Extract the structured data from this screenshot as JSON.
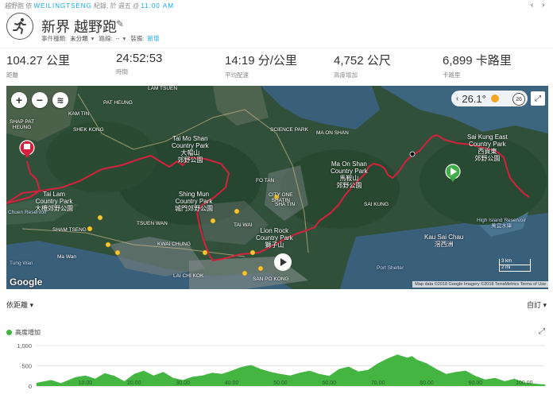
{
  "breadcrumb": {
    "activity_type": "越野跑",
    "by": "依",
    "user": "WEILINGTSENG",
    "record": "紀錄,",
    "at": "於 週五 @",
    "time": "11:00 AM"
  },
  "header": {
    "title": "新界 越野跑",
    "meta": {
      "event_type_label": "事件種類:",
      "event_type_value": "未分類",
      "course_label": "路線:",
      "course_value": "--",
      "gear_label": "裝備:",
      "gear_value": "新增"
    }
  },
  "stats": [
    {
      "value": "104.27 公里",
      "label": "距離"
    },
    {
      "value": "24:52:53",
      "label": "時間"
    },
    {
      "value": "14:19 分/公里",
      "label": "平均配速"
    },
    {
      "value": "4,752 公尺",
      "label": "高度增加"
    },
    {
      "value": "6,899 卡路里",
      "label": "卡路里"
    }
  ],
  "map": {
    "zoom_in": "+",
    "zoom_out": "−",
    "weather_temp": "26.1°",
    "wind": "26",
    "scale_km": "3 km",
    "scale_mi": "2 mi",
    "google": "Google",
    "attribution": "Map data ©2018 Google Imagery ©2018 TerraMetrics   Terms of Use",
    "labels": {
      "shap_pat_heung": "SHAP PAT\nHEUNG",
      "pat_heung": "PAT HEUNG",
      "lam_tsuen": "LAM TSUEN",
      "kam_tin": "KAM TIN",
      "shek_kong": "SHEK KONG",
      "tai_mo_shan": "Tai Mo Shan\nCountry Park\n大帽山\n郊野公園",
      "tai_lam": "Tai Lam\nCountry Park\n大欖郊野公園",
      "chuen_reservoir": "Chuen Reservoir",
      "shing_mun": "Shing Mun\nCountry Park\n城門郊野公園",
      "science_park": "SCIENCE PARK",
      "ma_on_shan_town": "MA ON SHAN",
      "ma_on_shan": "Ma On Shan\nCountry Park\n馬鞍山\n郊野公園",
      "sai_kung_east": "Sai Kung East\nCountry Park\n西貢東\n郊野公園",
      "fo_tan": "FO TAN",
      "city_one": "CITY ONE\nSHATIN",
      "sha_tin": "SHA TIN",
      "sai_kung": "SAI KUNG",
      "tai_wai": "TAI WAI",
      "lion_rock": "Lion Rock\nCountry Park\n獅子山",
      "sham_tseng": "SHAM TSENG",
      "tsuen_wan": "TSUEN WAN",
      "kwai_chung": "KWAI CHUNG",
      "tung_wan": "Tung Wan",
      "ma_wan": "Ma Wan",
      "lai_chi_kok": "LAI CHI KOK",
      "san_po_kong": "SAN PO KONG",
      "kau_sai_chau": "Kau Sai Chau\n滘西洲",
      "high_island": "High Island Reservoir\n萬宜水庫",
      "port_shelter": "Port Shelter"
    }
  },
  "lower": {
    "distance_selector": "依距離",
    "custom_selector": "自訂",
    "elevation_legend": "高度增加"
  },
  "chart_data": {
    "type": "area",
    "title": "",
    "xlabel": "",
    "ylabel": "",
    "x_ticks": [
      "10.00",
      "20.00",
      "30.00",
      "40.00",
      "50.00",
      "60.00",
      "70.00",
      "80.00",
      "90.00",
      "100.00"
    ],
    "y_ticks": [
      "1,000",
      "500",
      "0"
    ],
    "ylim": [
      0,
      1000
    ],
    "xlim": [
      0,
      104.27
    ],
    "series": [
      {
        "name": "高度增加",
        "color": "#44b541",
        "x": [
          0,
          3,
          5,
          8,
          10,
          12,
          14,
          16,
          18,
          20,
          22,
          24,
          26,
          28,
          30,
          32,
          34,
          36,
          38,
          40,
          42,
          44,
          46,
          48,
          50,
          52,
          54,
          56,
          58,
          60,
          62,
          64,
          66,
          68,
          70,
          72,
          74,
          76,
          77,
          78,
          80,
          82,
          84,
          86,
          88,
          90,
          92,
          94,
          96,
          98,
          100,
          102,
          104.27
        ],
        "values": [
          80,
          150,
          70,
          220,
          260,
          180,
          320,
          250,
          120,
          300,
          380,
          260,
          350,
          200,
          150,
          230,
          260,
          330,
          300,
          380,
          470,
          520,
          420,
          350,
          300,
          260,
          330,
          380,
          300,
          250,
          420,
          480,
          360,
          400,
          560,
          680,
          780,
          700,
          740,
          650,
          560,
          420,
          300,
          350,
          380,
          250,
          160,
          200,
          120,
          180,
          90,
          60,
          40
        ]
      }
    ]
  }
}
